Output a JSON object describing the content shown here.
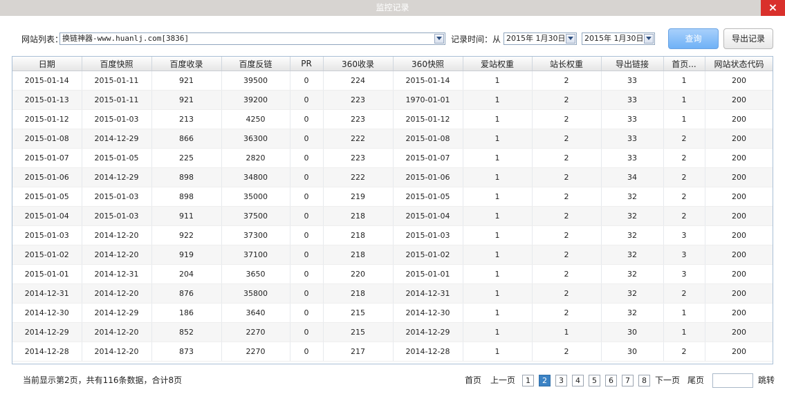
{
  "window": {
    "title": "监控记录",
    "close_glyph": "×"
  },
  "toolbar": {
    "site_label": "网站列表：",
    "site_value": "换链神器-www.huanlj.com[3836]",
    "time_label": "记录时间：从",
    "date_from": "2015年 1月30日",
    "date_to": "2015年 1月30日",
    "query_label": "查询",
    "export_label": "导出记录"
  },
  "table": {
    "columns": [
      "日期",
      "百度快照",
      "百度收录",
      "百度反链",
      "PR",
      "360收录",
      "360快照",
      "爱站权重",
      "站长权重",
      "导出链接",
      "首页...",
      "网站状态代码"
    ],
    "rows": [
      [
        "2015-01-14",
        "2015-01-11",
        "921",
        "39500",
        "0",
        "224",
        "2015-01-14",
        "1",
        "2",
        "33",
        "1",
        "200"
      ],
      [
        "2015-01-13",
        "2015-01-11",
        "921",
        "39200",
        "0",
        "223",
        "1970-01-01",
        "1",
        "2",
        "33",
        "1",
        "200"
      ],
      [
        "2015-01-12",
        "2015-01-03",
        "213",
        "4250",
        "0",
        "223",
        "2015-01-12",
        "1",
        "2",
        "33",
        "1",
        "200"
      ],
      [
        "2015-01-08",
        "2014-12-29",
        "866",
        "36300",
        "0",
        "222",
        "2015-01-08",
        "1",
        "2",
        "33",
        "2",
        "200"
      ],
      [
        "2015-01-07",
        "2015-01-05",
        "225",
        "2820",
        "0",
        "223",
        "2015-01-07",
        "1",
        "2",
        "33",
        "2",
        "200"
      ],
      [
        "2015-01-06",
        "2014-12-29",
        "898",
        "34800",
        "0",
        "222",
        "2015-01-06",
        "1",
        "2",
        "34",
        "2",
        "200"
      ],
      [
        "2015-01-05",
        "2015-01-03",
        "898",
        "35000",
        "0",
        "219",
        "2015-01-05",
        "1",
        "2",
        "32",
        "2",
        "200"
      ],
      [
        "2015-01-04",
        "2015-01-03",
        "911",
        "37500",
        "0",
        "218",
        "2015-01-04",
        "1",
        "2",
        "32",
        "2",
        "200"
      ],
      [
        "2015-01-03",
        "2014-12-20",
        "922",
        "37300",
        "0",
        "218",
        "2015-01-03",
        "1",
        "2",
        "32",
        "3",
        "200"
      ],
      [
        "2015-01-02",
        "2014-12-20",
        "919",
        "37100",
        "0",
        "218",
        "2015-01-02",
        "1",
        "2",
        "32",
        "3",
        "200"
      ],
      [
        "2015-01-01",
        "2014-12-31",
        "204",
        "3650",
        "0",
        "220",
        "2015-01-01",
        "1",
        "2",
        "32",
        "3",
        "200"
      ],
      [
        "2014-12-31",
        "2014-12-20",
        "876",
        "35800",
        "0",
        "218",
        "2014-12-31",
        "1",
        "2",
        "32",
        "2",
        "200"
      ],
      [
        "2014-12-30",
        "2014-12-29",
        "186",
        "3640",
        "0",
        "215",
        "2014-12-30",
        "1",
        "2",
        "32",
        "1",
        "200"
      ],
      [
        "2014-12-29",
        "2014-12-20",
        "852",
        "2270",
        "0",
        "215",
        "2014-12-29",
        "1",
        "1",
        "30",
        "1",
        "200"
      ],
      [
        "2014-12-28",
        "2014-12-20",
        "873",
        "2270",
        "0",
        "217",
        "2014-12-28",
        "1",
        "2",
        "30",
        "2",
        "200"
      ]
    ]
  },
  "footer": {
    "info": "当前显示第2页，共有116条数据，合计8页",
    "first": "首页",
    "prev": "上一页",
    "pages": [
      "1",
      "2",
      "3",
      "4",
      "5",
      "6",
      "7",
      "8"
    ],
    "active_page": "2",
    "next": "下一页",
    "last": "尾页",
    "jump": "跳转"
  }
}
